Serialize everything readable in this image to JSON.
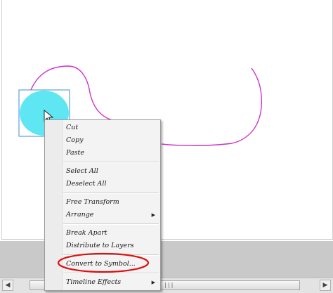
{
  "context_menu": {
    "items": [
      {
        "label": "Cut",
        "has_submenu": false
      },
      {
        "label": "Copy",
        "has_submenu": false
      },
      {
        "label": "Paste",
        "has_submenu": false
      },
      {
        "label": "Select All",
        "has_submenu": false
      },
      {
        "label": "Deselect All",
        "has_submenu": false
      },
      {
        "label": "Free Transform",
        "has_submenu": false
      },
      {
        "label": "Arrange",
        "has_submenu": true
      },
      {
        "label": "Break Apart",
        "has_submenu": false
      },
      {
        "label": "Distribute to Layers",
        "has_submenu": false
      },
      {
        "label": "Convert to Symbol...",
        "has_submenu": false
      },
      {
        "label": "Timeline Effects",
        "has_submenu": true
      }
    ],
    "highlighted_item": "Convert to Symbol..."
  },
  "scrollbar": {
    "left_arrow": "◀",
    "right_arrow": "▶",
    "grip": "|||"
  },
  "colors": {
    "circle_fill": "#5ee6f2",
    "selection_box": "#3a8fd8",
    "stroke_line": "#cc33cc",
    "highlight_ellipse": "#dd1111"
  },
  "icons": {
    "cursor": "arrow-pointer-icon",
    "submenu": "triangle-right-icon"
  }
}
